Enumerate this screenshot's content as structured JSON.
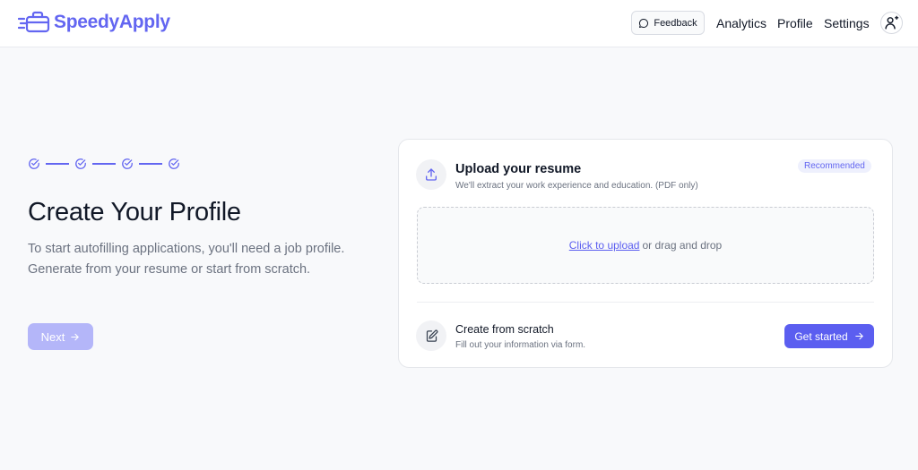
{
  "app": {
    "name": "SpeedyApply",
    "logo_icon": "briefcase-speed-icon",
    "accent": "#6366f1"
  },
  "header": {
    "feedback_label": "Feedback",
    "feedback_icon": "chat-bubble-icon",
    "nav": [
      "Analytics",
      "Profile",
      "Settings"
    ],
    "avatar_icon": "user-plus-icon"
  },
  "stepper": {
    "steps": 4,
    "step_icon": "check-circle-icon"
  },
  "main": {
    "title": "Create Your Profile",
    "description_line1": "To start autofilling applications, you'll need a job profile.",
    "description_line2": "Generate from your resume or start from scratch.",
    "next_label": "Next"
  },
  "upload": {
    "title": "Upload your resume",
    "subtitle": "We'll extract your work experience and education. (PDF only)",
    "badge": "Recommended",
    "link_text": "Click to upload",
    "drop_text": "or drag and drop",
    "icon": "upload-icon"
  },
  "scratch": {
    "title": "Create from scratch",
    "subtitle": "Fill out your information via form.",
    "button_label": "Get started",
    "icon": "edit-document-icon"
  }
}
